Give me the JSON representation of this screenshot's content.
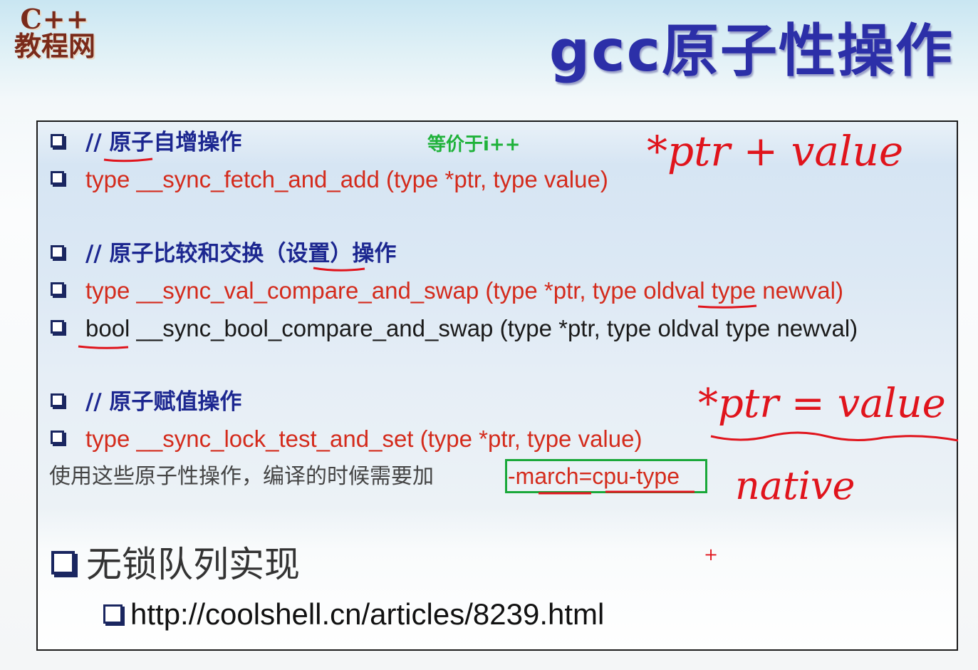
{
  "logo": {
    "line1": "C++",
    "line2": "教程网"
  },
  "title": "gcc原子性操作",
  "sections": {
    "increment": {
      "comment": "// 原子自增操作",
      "code": "type __sync_fetch_and_add (type *ptr, type value)",
      "note": "等价于i++"
    },
    "cas": {
      "comment": "// 原子比较和交换（设置）操作",
      "code_val": "type __sync_val_compare_and_swap (type *ptr, type oldval type newval)",
      "code_bool": "bool __sync_bool_compare_and_swap (type *ptr, type oldval type newval)"
    },
    "assign": {
      "comment": "// 原子赋值操作",
      "code": "type __sync_lock_test_and_set (type *ptr, type value)"
    },
    "compile_note": {
      "text": "使用这些原子性操作，编译的时候需要加",
      "flag": "-march=cpu-type"
    },
    "lockfree": {
      "heading": "无锁队列实现",
      "url": "http://coolshell.cn/articles/8239.html"
    }
  },
  "annotations": {
    "add_expr": "*ptr + value",
    "assign_expr": "*ptr = value",
    "native": "native",
    "plus": "+"
  },
  "colors": {
    "title": "#2c2fa8",
    "comment": "#1c2790",
    "code": "#d42b1c",
    "handwriting": "#e0141c",
    "green_note": "#1fb23a",
    "highlight_box": "#1aa83a"
  }
}
